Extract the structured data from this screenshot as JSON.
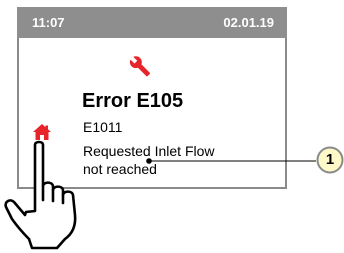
{
  "status": {
    "time": "11:07",
    "date": "02.01.19"
  },
  "error": {
    "title": "Error E105",
    "code": "E1011",
    "message_line1": "Requested Inlet Flow",
    "message_line2": "not reached"
  },
  "callout": {
    "number": "1"
  },
  "icons": {
    "wrench": "wrench-icon",
    "home": "home-icon",
    "hand": "pointing-hand-icon"
  },
  "colors": {
    "accent_red": "#e8242b",
    "status_bar": "#8e8e8e",
    "callout_fill": "#fff8c8",
    "callout_border": "#8a8a8a"
  }
}
